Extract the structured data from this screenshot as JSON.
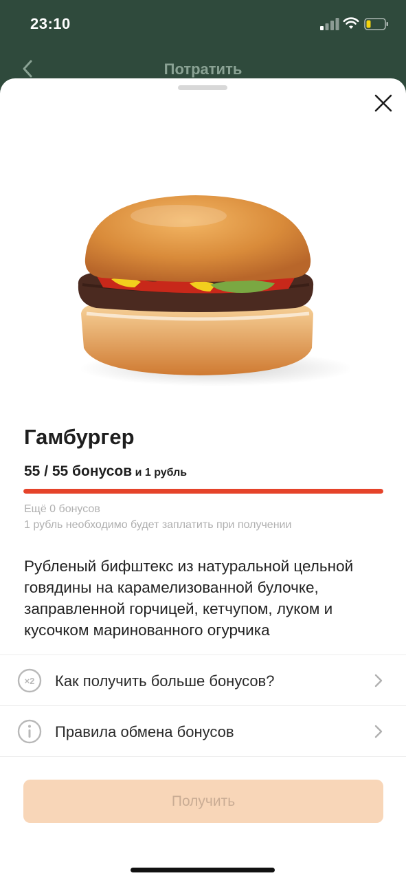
{
  "status_bar": {
    "time": "23:10",
    "icons": [
      "signal-icon",
      "wifi-icon",
      "battery-icon"
    ]
  },
  "nav": {
    "title": "Потратить",
    "back_icon": "chevron-left-icon"
  },
  "sheet": {
    "close_icon": "close-icon",
    "product": {
      "image": "hamburger-image",
      "title": "Гамбургер",
      "price_main": "55 / 55 бонусов",
      "price_extra": " и 1 рубль",
      "progress_fraction": 1.0,
      "hint_remaining": "Ещё 0 бонусов",
      "hint_payment": "1 рубль необходимо будет заплатить при получении",
      "description": "Рубленый бифштекс из натуральной цельной говядины на карамелизованной булочке, заправленной горчицей, кетчупом, луком и кусочком маринованного огурчика"
    },
    "menu": [
      {
        "label": "Как получить больше бонусов?",
        "icon": "x2-badge-icon"
      },
      {
        "label": "Правила обмена бонусов",
        "icon": "info-icon"
      }
    ],
    "get_button_label": "Получить"
  },
  "colors": {
    "header_bg": "#2f4a3c",
    "accent_red": "#e5432a",
    "button_bg": "#f8d6b8",
    "button_text": "#c9ac94"
  }
}
